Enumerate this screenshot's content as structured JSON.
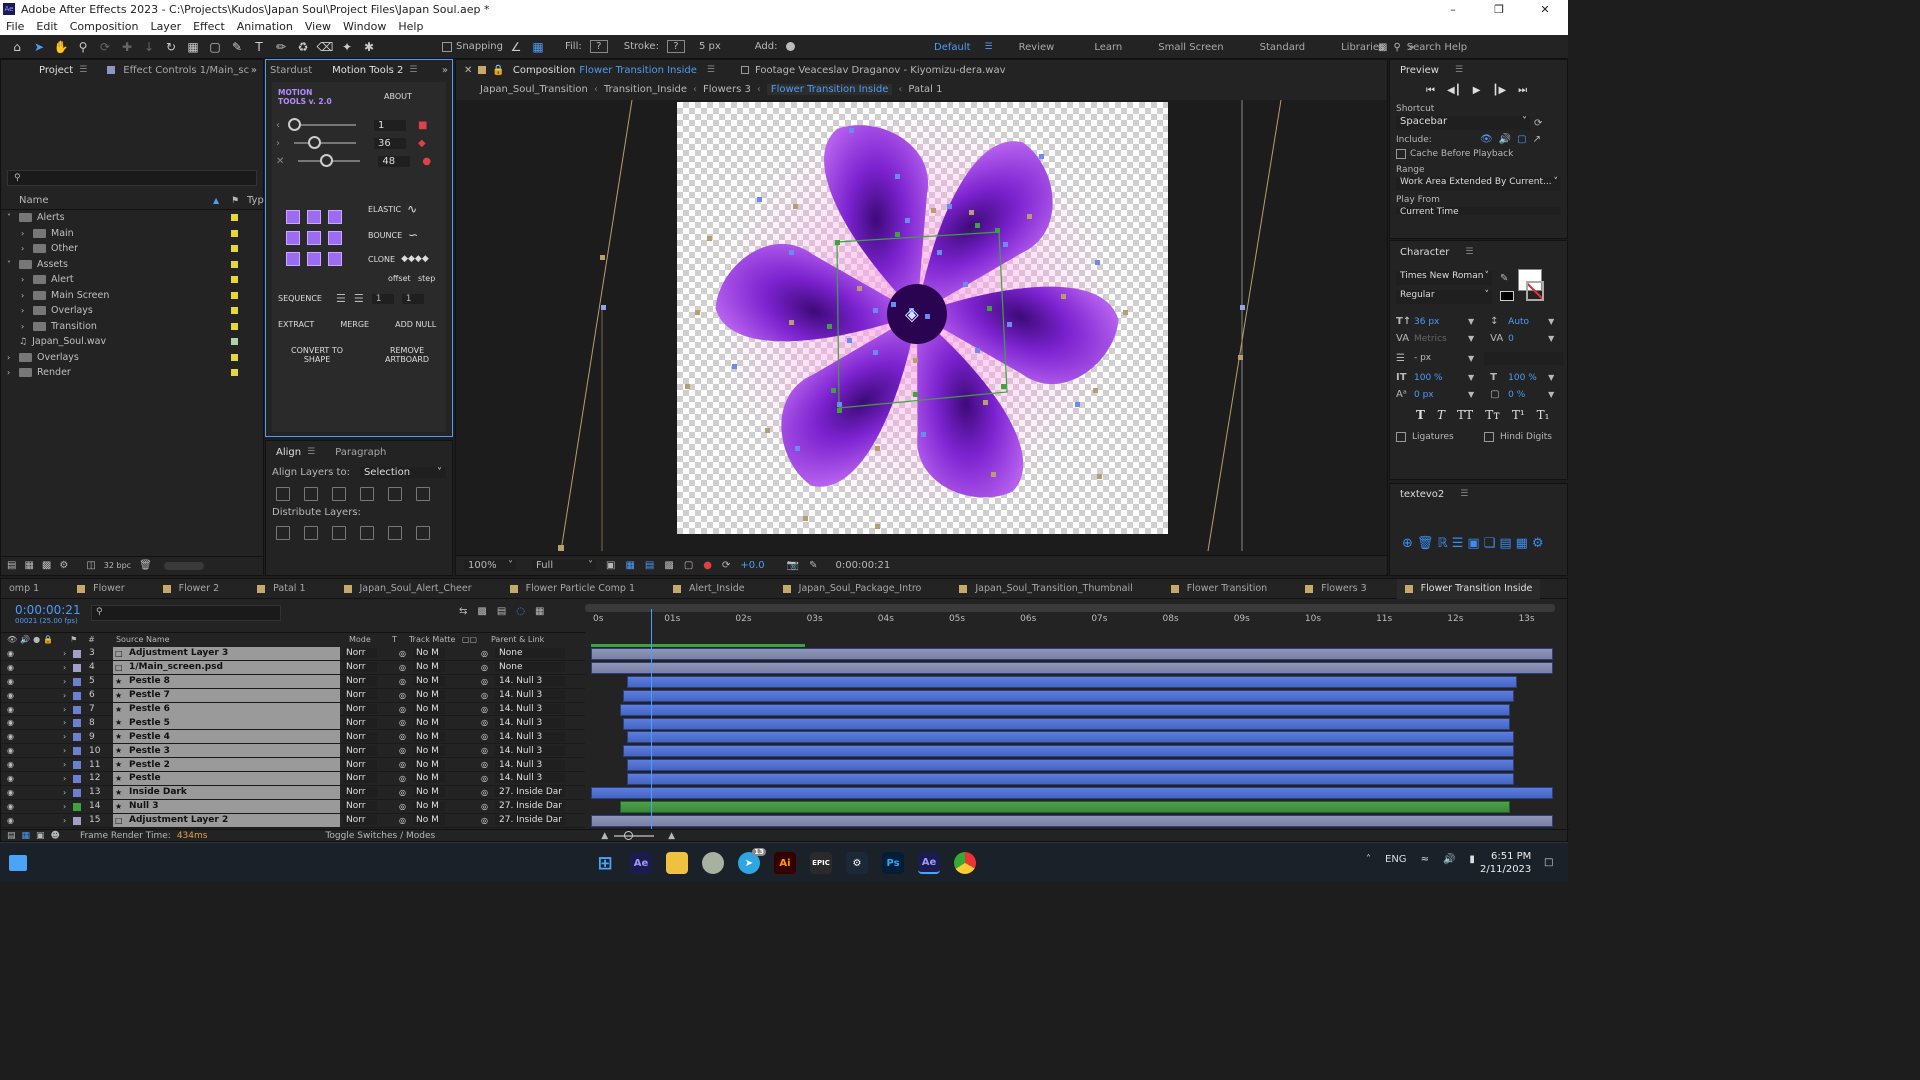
{
  "window": {
    "title": "Adobe After Effects 2023 - C:\\Projects\\Kudos\\Japan Soul\\Project Files\\Japan Soul.aep *",
    "app_badge": "Ae"
  },
  "menu": [
    "File",
    "Edit",
    "Composition",
    "Layer",
    "Effect",
    "Animation",
    "View",
    "Window",
    "Help"
  ],
  "toolbar": {
    "snapping": "Snapping",
    "fill": "Fill:",
    "stroke": "Stroke:",
    "stroke_px": "5 px",
    "add": "Add:",
    "fill_val": "?",
    "stroke_val": "?"
  },
  "workspaces": [
    "Default",
    "Review",
    "Learn",
    "Small Screen",
    "Standard",
    "Libraries"
  ],
  "search_help": "Search Help",
  "project": {
    "tab": "Project",
    "effect_controls": "Effect Controls 1/Main_sc",
    "name_header": "Name",
    "type_header": "Typ",
    "bpc": "32 bpc",
    "items": [
      {
        "label": "Alerts",
        "indent": 0,
        "expanded": true
      },
      {
        "label": "Main",
        "indent": 1
      },
      {
        "label": "Other",
        "indent": 1
      },
      {
        "label": "Assets",
        "indent": 0,
        "expanded": true
      },
      {
        "label": "Alert",
        "indent": 1
      },
      {
        "label": "Main Screen",
        "indent": 1
      },
      {
        "label": "Overlays",
        "indent": 1
      },
      {
        "label": "Transition",
        "indent": 1
      },
      {
        "label": "Japan_Soul.wav",
        "indent": 0,
        "file": true
      },
      {
        "label": "Overlays",
        "indent": 0
      },
      {
        "label": "Render",
        "indent": 0
      }
    ]
  },
  "motion_tools": {
    "tab_stardust": "Stardust",
    "tab_mt": "Motion Tools 2",
    "logo": "MOTION TOOLS v. 2.0",
    "about": "ABOUT",
    "sliders": [
      "1",
      "36",
      "48"
    ],
    "elastic": "ELASTIC",
    "bounce": "BOUNCE",
    "clone": "CLONE",
    "offset": "offset",
    "step": "step",
    "sequence": "SEQUENCE",
    "seq_vals": [
      "1",
      "1"
    ],
    "extract": "EXTRACT",
    "merge": "MERGE",
    "add_null": "ADD NULL",
    "convert": "CONVERT TO SHAPE",
    "remove": "REMOVE ARTBOARD"
  },
  "align": {
    "tab_align": "Align",
    "tab_paragraph": "Paragraph",
    "align_layers_to": "Align Layers to:",
    "selection": "Selection",
    "distribute": "Distribute Layers:"
  },
  "composition": {
    "tab_prefix": "Composition",
    "tab_name": "Flower Transition Inside",
    "footage": "Footage  Veaceslav Draganov - Kiyomizu-dera.wav",
    "breadcrumbs": [
      "Japan_Soul_Transition",
      "Transition_Inside",
      "Flowers 3",
      "Flower Transition Inside",
      "Patal 1"
    ],
    "zoom": "100%",
    "resolution": "Full",
    "exposure": "+0.0",
    "time": "0:00:00:21"
  },
  "preview": {
    "title": "Preview",
    "shortcut_label": "Shortcut",
    "shortcut": "Spacebar",
    "include": "Include:",
    "cache": "Cache Before Playback",
    "range_label": "Range",
    "range": "Work Area Extended By Current...",
    "play_from": "Play From",
    "play_from_val": "Current Time"
  },
  "character": {
    "title": "Character",
    "font": "Times New Roman",
    "style": "Regular",
    "size": "36 px",
    "leading": "Auto",
    "kerning": "Metrics",
    "tracking": "0",
    "stroke": "- px",
    "vscale": "100 %",
    "hscale": "100 %",
    "baseline": "0 px",
    "tsume": "0 %",
    "ligatures": "Ligatures",
    "hindi": "Hindi Digits"
  },
  "textevo": {
    "title": "textevo2"
  },
  "timeline": {
    "tabs": [
      "omp 1",
      "Flower",
      "Flower 2",
      "Patal 1",
      "Japan_Soul_Alert_Cheer",
      "Flower Particle Comp 1",
      "Alert_Inside",
      "Japan_Soul_Package_Intro",
      "Japan_Soul_Transition_Thumbnail",
      "Flower Transition",
      "Flowers 3",
      "Flower Transition Inside"
    ],
    "timecode": "0:00:00:21",
    "fps": "00021 (25.00 fps)",
    "headers": {
      "source": "Source Name",
      "mode": "Mode",
      "t": "T",
      "matte": "Track Matte",
      "parent": "Parent & Link"
    },
    "ruler": [
      "0s",
      "01s",
      "02s",
      "03s",
      "04s",
      "05s",
      "06s",
      "07s",
      "08s",
      "09s",
      "10s",
      "11s",
      "12s",
      "13s"
    ],
    "layers": [
      {
        "num": "3",
        "name": "Adjustment Layer 3",
        "mode": "Norr",
        "matte": "No M",
        "parent": "None",
        "color": "#a0a0c8",
        "bar": "grey",
        "start": 0.0,
        "end": 13.5
      },
      {
        "num": "4",
        "name": "1/Main_screen.psd",
        "mode": "Norr",
        "matte": "No M",
        "parent": "None",
        "color": "#a0a0c8",
        "bar": "grey",
        "start": 0.0,
        "end": 13.5
      },
      {
        "num": "5",
        "name": "Pestle 8",
        "mode": "Norr",
        "matte": "No M",
        "parent": "14. Null 3",
        "color": "#6f7fd0",
        "bar": "blue",
        "start": 0.5,
        "end": 13.0
      },
      {
        "num": "6",
        "name": "Pestle 7",
        "mode": "Norr",
        "matte": "No M",
        "parent": "14. Null 3",
        "color": "#6f7fd0",
        "bar": "blue",
        "start": 0.45,
        "end": 12.95
      },
      {
        "num": "7",
        "name": "Pestle 6",
        "mode": "Norr",
        "matte": "No M",
        "parent": "14. Null 3",
        "color": "#6f7fd0",
        "bar": "blue",
        "start": 0.4,
        "end": 12.9
      },
      {
        "num": "8",
        "name": "Pestle 5",
        "mode": "Norr",
        "matte": "No M",
        "parent": "14. Null 3",
        "color": "#6f7fd0",
        "bar": "blue",
        "start": 0.45,
        "end": 12.9
      },
      {
        "num": "9",
        "name": "Pestle 4",
        "mode": "Norr",
        "matte": "No M",
        "parent": "14. Null 3",
        "color": "#6f7fd0",
        "bar": "blue",
        "start": 0.5,
        "end": 12.95
      },
      {
        "num": "10",
        "name": "Pestle 3",
        "mode": "Norr",
        "matte": "No M",
        "parent": "14. Null 3",
        "color": "#6f7fd0",
        "bar": "blue",
        "start": 0.45,
        "end": 12.95
      },
      {
        "num": "11",
        "name": "Pestle 2",
        "mode": "Norr",
        "matte": "No M",
        "parent": "14. Null 3",
        "color": "#6f7fd0",
        "bar": "blue",
        "start": 0.5,
        "end": 12.95
      },
      {
        "num": "12",
        "name": "Pestle",
        "mode": "Norr",
        "matte": "No M",
        "parent": "14. Null 3",
        "color": "#6f7fd0",
        "bar": "blue",
        "start": 0.5,
        "end": 12.95
      },
      {
        "num": "13",
        "name": "Inside Dark",
        "mode": "Norr",
        "matte": "No M",
        "parent": "27. Inside Dar",
        "color": "#6f7fd0",
        "bar": "blue",
        "start": 0.0,
        "end": 13.5
      },
      {
        "num": "14",
        "name": "Null 3",
        "mode": "Norr",
        "matte": "No M",
        "parent": "27. Inside Dar",
        "color": "#3da33d",
        "bar": "green",
        "start": 0.4,
        "end": 12.9
      },
      {
        "num": "15",
        "name": "Adjustment Layer 2",
        "mode": "Norr",
        "matte": "No M",
        "parent": "27. Inside Dar",
        "color": "#a0a0c8",
        "bar": "grey",
        "start": 0.0,
        "end": 13.5
      }
    ],
    "frame_render": "Frame Render Time:",
    "frame_render_val": "434ms",
    "toggle": "Toggle Switches / Modes"
  },
  "taskbar": {
    "apps": [
      "Ae",
      "Ai",
      "EPIC",
      "Ps",
      "Ae"
    ],
    "badge": "13",
    "lang": "ENG",
    "time": "6:51 PM",
    "date": "2/11/2023"
  }
}
